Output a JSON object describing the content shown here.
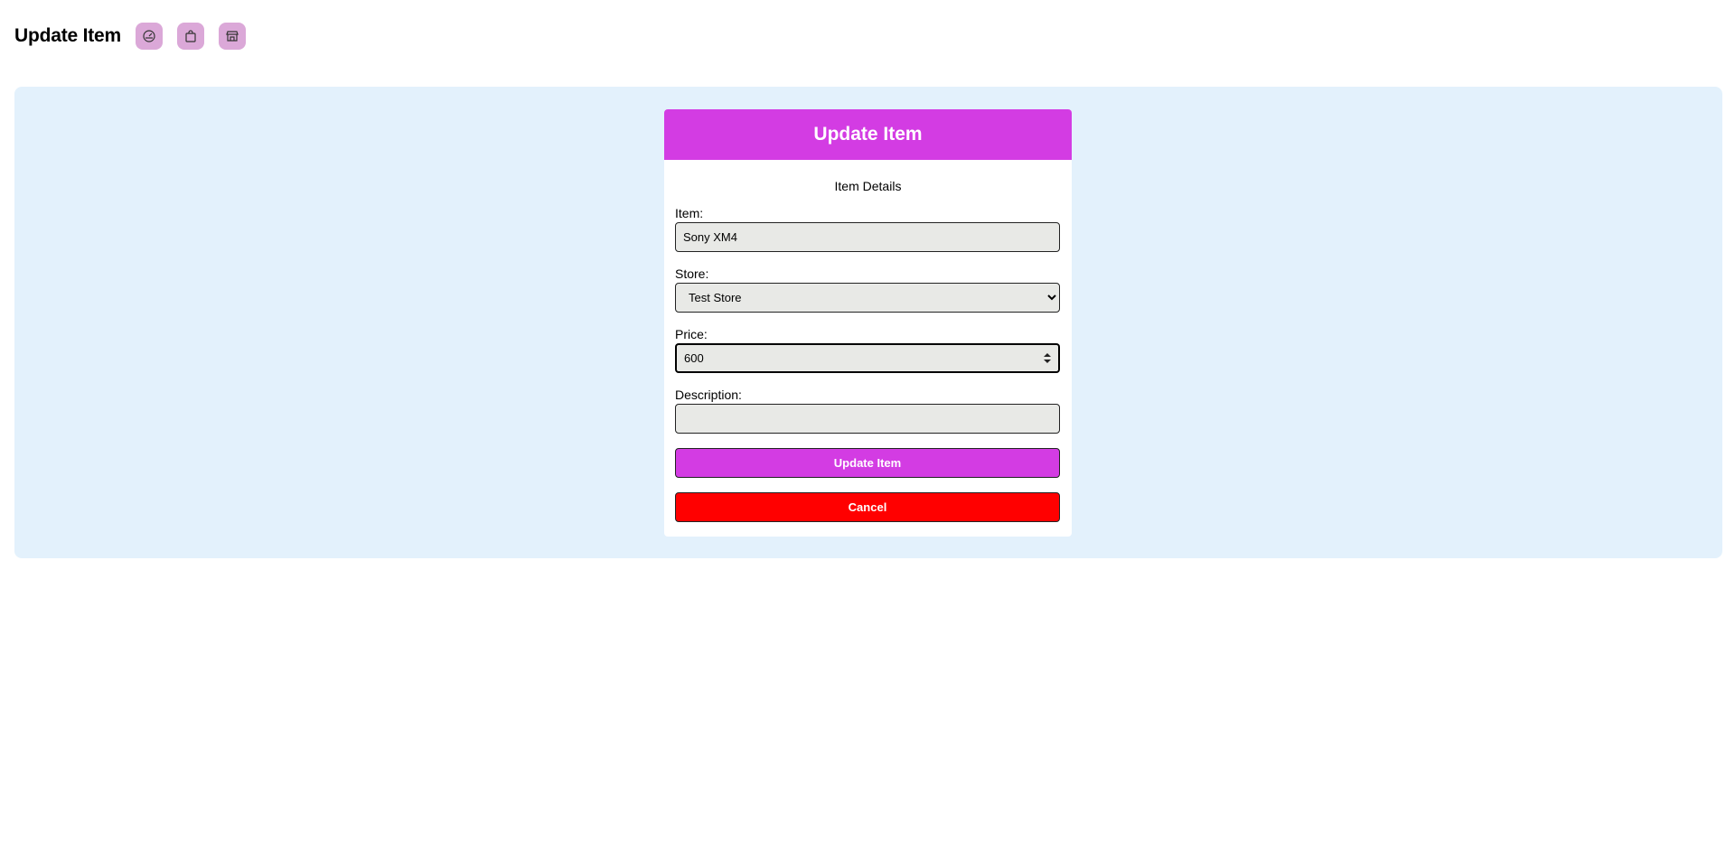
{
  "header": {
    "title": "Update Item",
    "nav": [
      {
        "icon": "dashboard-icon"
      },
      {
        "icon": "shopping-bag-icon"
      },
      {
        "icon": "store-icon"
      }
    ]
  },
  "form": {
    "card_title": "Update Item",
    "subtitle": "Item Details",
    "item": {
      "label": "Item:",
      "value": "Sony XM4"
    },
    "store": {
      "label": "Store:",
      "selected": "Test Store"
    },
    "price": {
      "label": "Price:",
      "value": "600"
    },
    "description": {
      "label": "Description:",
      "value": ""
    },
    "update_label": "Update Item",
    "cancel_label": "Cancel"
  },
  "colors": {
    "accent": "#d33ce3",
    "danger": "#ff0000",
    "panel_bg": "#e3f1fc",
    "nav_button_bg": "#dba8d8"
  }
}
